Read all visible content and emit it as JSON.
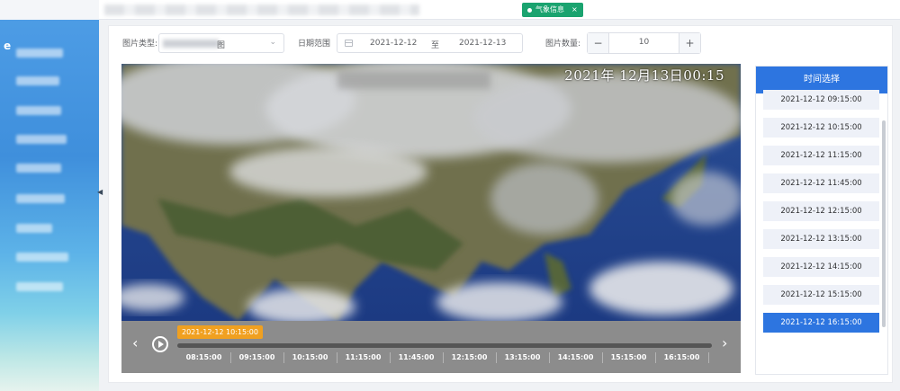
{
  "topbar": {
    "active_tab": "气象信息",
    "close_glyph": "×"
  },
  "filters": {
    "type_label": "图片类型:",
    "type_value_suffix": "图",
    "date_label": "日期范围",
    "date_start": "2021-12-12",
    "date_separator": "至",
    "date_end": "2021-12-13",
    "count_label": "图片数量:",
    "count_value": "10",
    "minus_glyph": "−",
    "plus_glyph": "+"
  },
  "map": {
    "timestamp": "2021年 12月13日00:15"
  },
  "timeline": {
    "current_time": "2021-12-12 10:15:00",
    "prev_glyph": "‹",
    "next_glyph": "›",
    "ticks": [
      "08:15:00",
      "09:15:00",
      "10:15:00",
      "11:15:00",
      "11:45:00",
      "12:15:00",
      "13:15:00",
      "14:15:00",
      "15:15:00",
      "16:15:00"
    ]
  },
  "time_panel": {
    "title": "时间选择",
    "items": [
      "2021-12-12 09:15:00",
      "2021-12-12 10:15:00",
      "2021-12-12 11:15:00",
      "2021-12-12 11:45:00",
      "2021-12-12 12:15:00",
      "2021-12-12 13:15:00",
      "2021-12-12 14:15:00",
      "2021-12-12 15:15:00",
      "2021-12-12 16:15:00"
    ],
    "selected": "2021-12-12 16:15:00"
  }
}
